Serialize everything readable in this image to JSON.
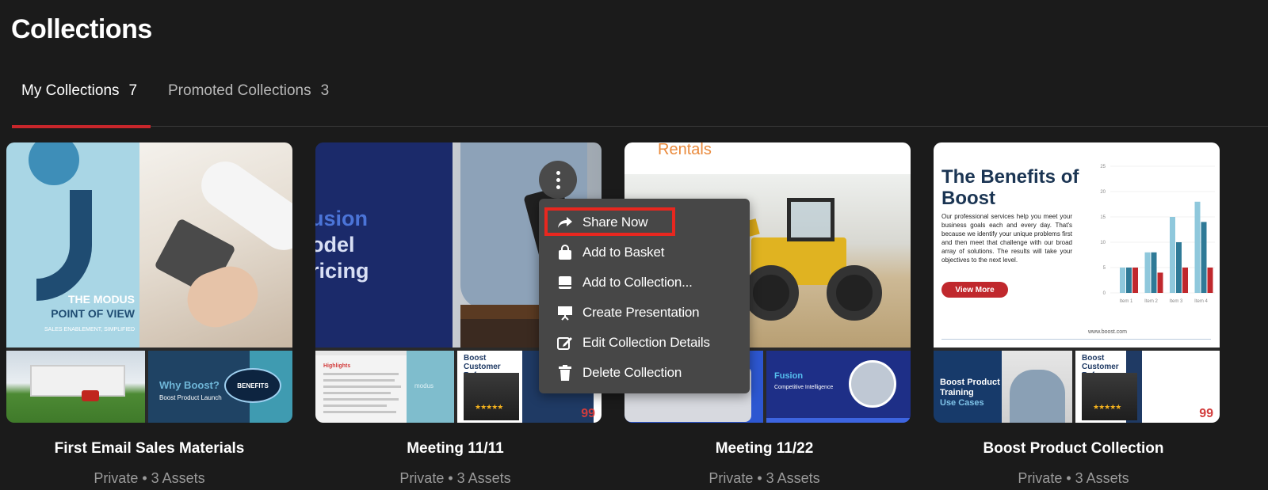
{
  "header": {
    "title": "Collections"
  },
  "tabs": [
    {
      "label": "My Collections",
      "count": "7",
      "active": true
    },
    {
      "label": "Promoted Collections",
      "count": "3",
      "active": false
    }
  ],
  "colors": {
    "accent": "#c8262b",
    "background": "#1b1b1b",
    "menu_bg": "#474747",
    "highlight": "#e8271f"
  },
  "cards": [
    {
      "name": "First Email Sales Materials",
      "meta": "Private • 3 Assets",
      "thumb_main": {
        "line1": "THE MODUS",
        "line2": "POINT OF VIEW",
        "line3": "SALES ENABLEMENT, SIMPLIFIED"
      },
      "thumb_sub": {
        "title": "Why Boost?",
        "subtitle": "Boost Product Launch",
        "badge": "BENEFITS"
      }
    },
    {
      "name": "Meeting 11/11",
      "meta": "Private • 3 Assets",
      "thumb_main": {
        "line1": "usion",
        "line2": "odel",
        "line3": "ricing"
      },
      "thumb_sub": {
        "doc_title": "Highlights",
        "doc_img_label": "modus",
        "ref_title": "Boost Customer Reference",
        "stars": "★★★★★",
        "quote": "99"
      }
    },
    {
      "name": "Meeting 11/22",
      "meta": "Private • 3 Assets",
      "thumb_main": {
        "heading": "Rentals"
      },
      "thumb_sub": {
        "title": "Fusion",
        "subtitle": "Competitive Intelligence"
      }
    },
    {
      "name": "Boost Product Collection",
      "meta": "Private • 3 Assets",
      "thumb_main": {
        "title": "The Benefits of Boost",
        "body": "Our professional services help you meet your business goals each and every day. That's because we identify your unique problems first and then meet that challenge with our broad array of solutions. The results will take your objectives to the next level.",
        "button": "View More",
        "url": "www.boost.com"
      },
      "thumb_sub": {
        "title": "Boost Product Training",
        "subtitle": "Use Cases",
        "ref_title": "Boost Customer Reference",
        "stars": "★★★★★",
        "quote": "99"
      }
    }
  ],
  "chart_data": {
    "type": "bar",
    "categories": [
      "Item 1",
      "Item 2",
      "Item 3",
      "Item 4"
    ],
    "series": [
      {
        "values": [
          5,
          8,
          15,
          18
        ],
        "color": "#8fc8dc"
      },
      {
        "values": [
          5,
          8,
          10,
          14
        ],
        "color": "#2f7a97"
      },
      {
        "values": [
          5,
          4,
          5,
          5
        ],
        "color": "#c0282d"
      }
    ],
    "ylim": [
      0,
      25
    ],
    "yticks": [
      "0",
      "5",
      "10",
      "15",
      "20",
      "25"
    ]
  },
  "context_menu": {
    "items": [
      {
        "label": "Share Now",
        "icon": "share-arrow-icon"
      },
      {
        "label": "Add to Basket",
        "icon": "basket-icon"
      },
      {
        "label": "Add to Collection...",
        "icon": "collection-icon"
      },
      {
        "label": "Create Presentation",
        "icon": "presentation-icon"
      },
      {
        "label": "Edit Collection Details",
        "icon": "edit-icon"
      },
      {
        "label": "Delete Collection",
        "icon": "trash-icon"
      }
    ]
  }
}
